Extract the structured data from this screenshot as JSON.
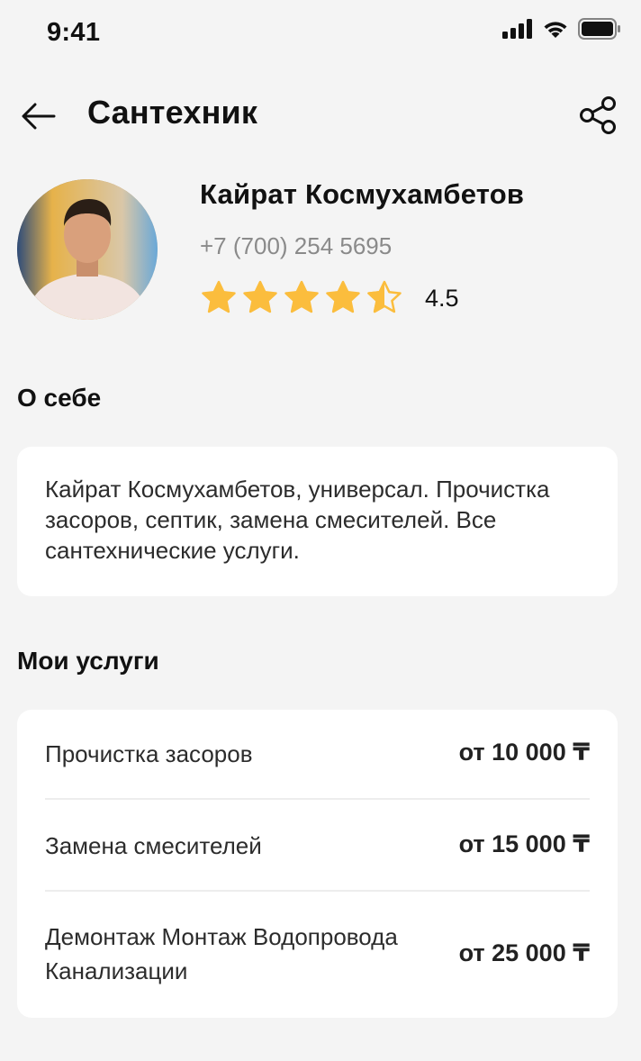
{
  "status_bar": {
    "time": "9:41"
  },
  "header": {
    "title": "Сантехник"
  },
  "profile": {
    "name": "Кайрат Космухамбетов",
    "phone": "+7 (700) 254 5695",
    "rating": 4.5,
    "rating_label": "4.5",
    "stars_max": 5
  },
  "about": {
    "title": "О себе",
    "text": "Кайрат Космухамбетов, универсал. Прочистка засоров, септик, замена смесителей. Все сантехнические услуги."
  },
  "services": {
    "title": "Мои услуги",
    "items": [
      {
        "name": "Прочистка засоров",
        "price": "от 10 000 ₸"
      },
      {
        "name": "Замена смесителей",
        "price": "от 15 000 ₸"
      },
      {
        "name": "Демонтаж Монтаж Водопровода Канализации",
        "price": "от 25 000 ₸"
      }
    ]
  },
  "colors": {
    "background": "#f4f4f4",
    "card": "#ffffff",
    "star": "#fbbd3d",
    "muted_text": "#8a8a8a"
  },
  "icons": {
    "back": "arrow-left-icon",
    "share": "share-icon",
    "star": "star-icon"
  }
}
